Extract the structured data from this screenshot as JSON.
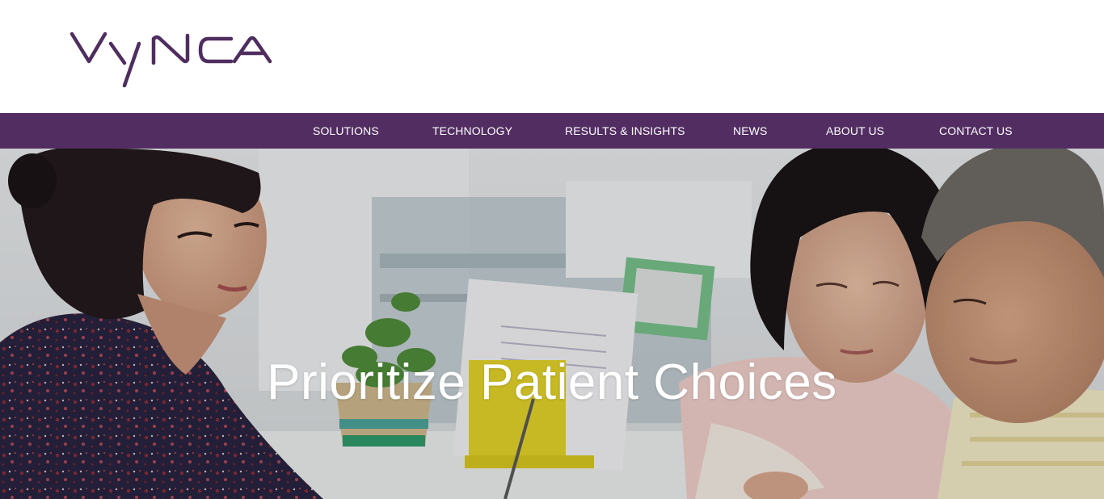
{
  "brand": {
    "logo_text": "Vynca",
    "logo_color": "#4f2d5f"
  },
  "nav": {
    "background": "#522d62",
    "items": [
      {
        "label": "SOLUTIONS"
      },
      {
        "label": "TECHNOLOGY"
      },
      {
        "label": "RESULTS & INSIGHTS"
      },
      {
        "label": "NEWS"
      },
      {
        "label": "ABOUT US"
      },
      {
        "label": "CONTACT US"
      }
    ]
  },
  "hero": {
    "heading": "Prioritize Patient Choices",
    "image_icon": "photo-family-consultation"
  }
}
